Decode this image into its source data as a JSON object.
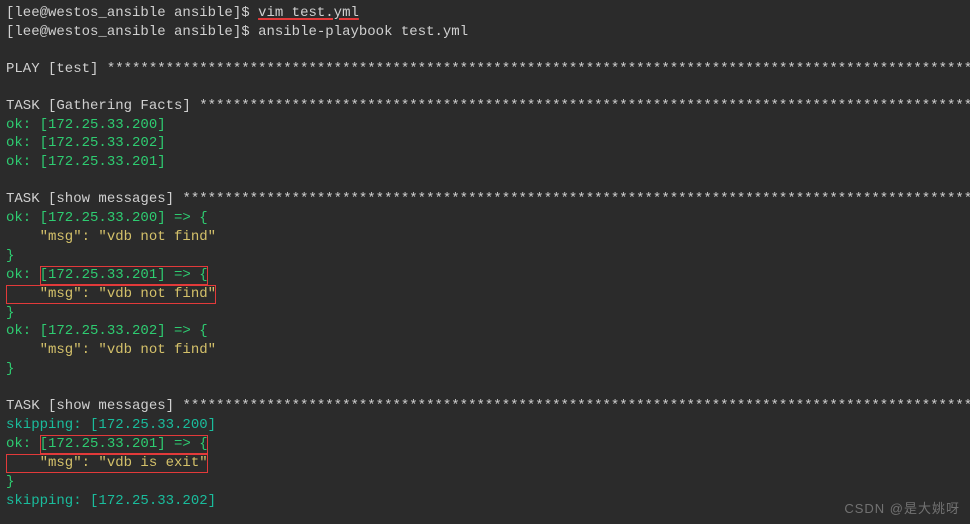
{
  "prompt": {
    "user_host": "[lee@westos_ansible ansible]",
    "symbol": "$"
  },
  "commands": {
    "cmd1": "vim test.yml",
    "cmd2": "ansible-playbook test.yml"
  },
  "sections": {
    "play_label": "PLAY [test] ",
    "play_stars": "*********************************************************************************************************",
    "task_facts_label": "TASK [Gathering Facts] ",
    "task_facts_stars": "**********************************************************************************************",
    "task_msgs_label": "TASK [show messages] ",
    "task_msgs_stars": "************************************************************************************************"
  },
  "facts": {
    "h1": "ok: [172.25.33.200]",
    "h2": "ok: [172.25.33.202]",
    "h3": "ok: [172.25.33.201]"
  },
  "msgs1": {
    "h1_open": "ok: [172.25.33.200] => {",
    "h1_msg": "    \"msg\": \"vdb not find\"",
    "h2_open_ok": "ok: ",
    "h2_open_rest": "[172.25.33.201] => {",
    "h2_msg": "    \"msg\": \"vdb not find\"",
    "h3_open": "ok: [172.25.33.202] => {",
    "h3_msg": "    \"msg\": \"vdb not find\"",
    "brace": "}"
  },
  "msgs2": {
    "skip1": "skipping: [172.25.33.200]",
    "h2_open_ok": "ok: ",
    "h2_open_rest": "[172.25.33.201] => {",
    "h2_msg": "    \"msg\": \"vdb is exit\"",
    "brace": "}",
    "skip2": "skipping: [172.25.33.202]"
  },
  "watermark": "CSDN @是大姚呀"
}
